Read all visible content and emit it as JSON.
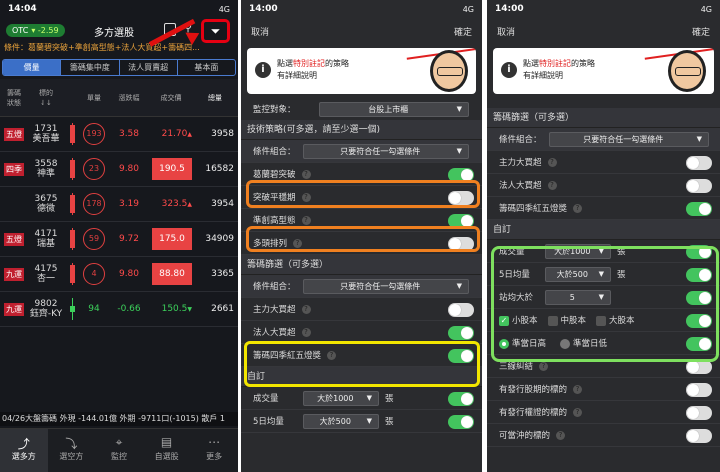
{
  "status": {
    "p1_time": "14:04",
    "p2_time": "14:00",
    "p3_time": "14:00",
    "signal": "4G"
  },
  "panel1": {
    "otc_label": "OTC",
    "otc_change": "▾ -2.59",
    "title": "多方選股",
    "conditions": "條件：葛蘭碧突破+準創高型態+法人大買超+籌碼四...",
    "segments": [
      "價量",
      "籌碼集中度",
      "法人買賣超",
      "基本面"
    ],
    "headers": [
      "籌碼\n狀態",
      "標的\n⇃↓",
      "",
      "單量",
      "漲跌幅",
      "成交價",
      "總量"
    ],
    "rows": [
      {
        "tag": "五燈",
        "code": "1731",
        "name": "美吾華",
        "unit": "193",
        "change": "3.58",
        "price": "21.70",
        "arrow": "▲",
        "vol": "3958",
        "hl": false,
        "dir": "up"
      },
      {
        "tag": "四季",
        "code": "3558",
        "name": "神準",
        "unit": "23",
        "change": "9.80",
        "price": "190.5",
        "arrow": "",
        "vol": "16582",
        "hl": true,
        "dir": "up"
      },
      {
        "tag": "",
        "code": "3675",
        "name": "德微",
        "unit": "178",
        "change": "3.19",
        "price": "323.5",
        "arrow": "▲",
        "vol": "3954",
        "hl": false,
        "dir": "up"
      },
      {
        "tag": "五燈",
        "code": "4171",
        "name": "瑞基",
        "unit": "59",
        "change": "9.72",
        "price": "175.0",
        "arrow": "",
        "vol": "34909",
        "hl": true,
        "dir": "up"
      },
      {
        "tag": "九運",
        "code": "4175",
        "name": "杏一",
        "unit": "4",
        "change": "9.80",
        "price": "88.80",
        "arrow": "",
        "vol": "3365",
        "hl": true,
        "dir": "up"
      },
      {
        "tag": "九運",
        "code": "9802",
        "name": "鈺齊-KY",
        "unit": "94",
        "change": "-0.66",
        "price": "150.5",
        "arrow": "▼",
        "vol": "2661",
        "hl": false,
        "dir": "down"
      }
    ],
    "ticker": "04/26大盤籌碼 外現 -144.01億  外期 -9711口(-1015)  散戶 1",
    "tabs": [
      "選多方",
      "選空方",
      "監控",
      "自選股",
      "更多"
    ]
  },
  "panel2": {
    "cancel": "取消",
    "confirm": "確定",
    "banner_line1a": "點選",
    "banner_hl": "特別註記",
    "banner_line1b": "的策略",
    "banner_line2": "有詳細說明",
    "monitor_label": "監控對象：",
    "monitor_value": "台股上市櫃",
    "tech_section": "技術策略(可多選，請至少選一個)",
    "combo_label": "條件組合：",
    "combo_value": "只要符合任一勾選條件",
    "tech_items": [
      {
        "label": "葛蘭碧突破",
        "on": true
      },
      {
        "label": "突破平穩期",
        "on": false
      },
      {
        "label": "準創高型態",
        "on": true
      },
      {
        "label": "多頭排列",
        "on": false
      }
    ],
    "chip_section": "籌碼篩選（可多選）",
    "chip_items": [
      {
        "label": "主力大買超",
        "on": false
      },
      {
        "label": "法人大買超",
        "on": true
      },
      {
        "label": "籌碼四季紅五燈獎",
        "on": true
      }
    ],
    "custom_section": "自訂",
    "custom_items": [
      {
        "label": "成交量",
        "value": "大於1000",
        "unit": "張"
      },
      {
        "label": "5日均量",
        "value": "大於500",
        "unit": "張"
      }
    ]
  },
  "panel3": {
    "cancel": "取消",
    "confirm": "確定",
    "banner_line1a": "點選",
    "banner_hl": "特別註記",
    "banner_line1b": "的策略",
    "banner_line2": "有詳細說明",
    "chip_section": "籌碼篩選（可多選）",
    "combo_label": "條件組合：",
    "combo_value": "只要符合任一勾選條件",
    "chip_items": [
      {
        "label": "主力大買超",
        "on": false
      },
      {
        "label": "法人大買超",
        "on": false
      },
      {
        "label": "籌碼四季紅五燈獎",
        "on": true
      }
    ],
    "custom_section": "自訂",
    "custom_items": [
      {
        "label": "成交量",
        "value": "大於1000",
        "unit": "張"
      },
      {
        "label": "5日均量",
        "value": "大於500",
        "unit": "張"
      },
      {
        "label": "站均大於",
        "value": "5",
        "unit": ""
      }
    ],
    "size_options": [
      "小股本",
      "中股本",
      "大股本"
    ],
    "day_options": [
      "準當日高",
      "準當日低"
    ],
    "extra_items": [
      "三線糾結",
      "有發行股期的標的",
      "有發行權證的標的",
      "可當沖的標的"
    ]
  }
}
